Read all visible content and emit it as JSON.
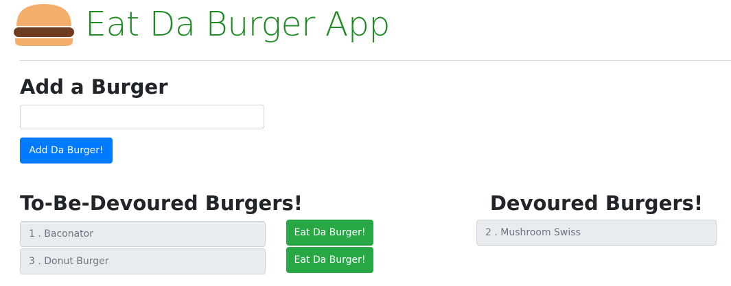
{
  "header": {
    "title": "Eat Da Burger App",
    "logo_icon": "burger-icon"
  },
  "add_section": {
    "title": "Add a Burger",
    "input_value": "",
    "input_placeholder": "",
    "button_label": "Add Da Burger!"
  },
  "todo_section": {
    "title": "To-Be-Devoured Burgers!",
    "items": [
      {
        "label": "1 . Baconator",
        "button_label": "Eat Da Burger!"
      },
      {
        "label": "3 . Donut Burger",
        "button_label": "Eat Da Burger!"
      }
    ]
  },
  "devoured_section": {
    "title": "Devoured Burgers!",
    "items": [
      {
        "label": "2 . Mushroom Swiss"
      }
    ]
  },
  "colors": {
    "title_green": "#1f8b24",
    "primary_blue": "#007bff",
    "success_green": "#28a745",
    "item_bg": "#e9ecef",
    "bun": "#f4ae6b",
    "patty": "#6e3d21"
  }
}
